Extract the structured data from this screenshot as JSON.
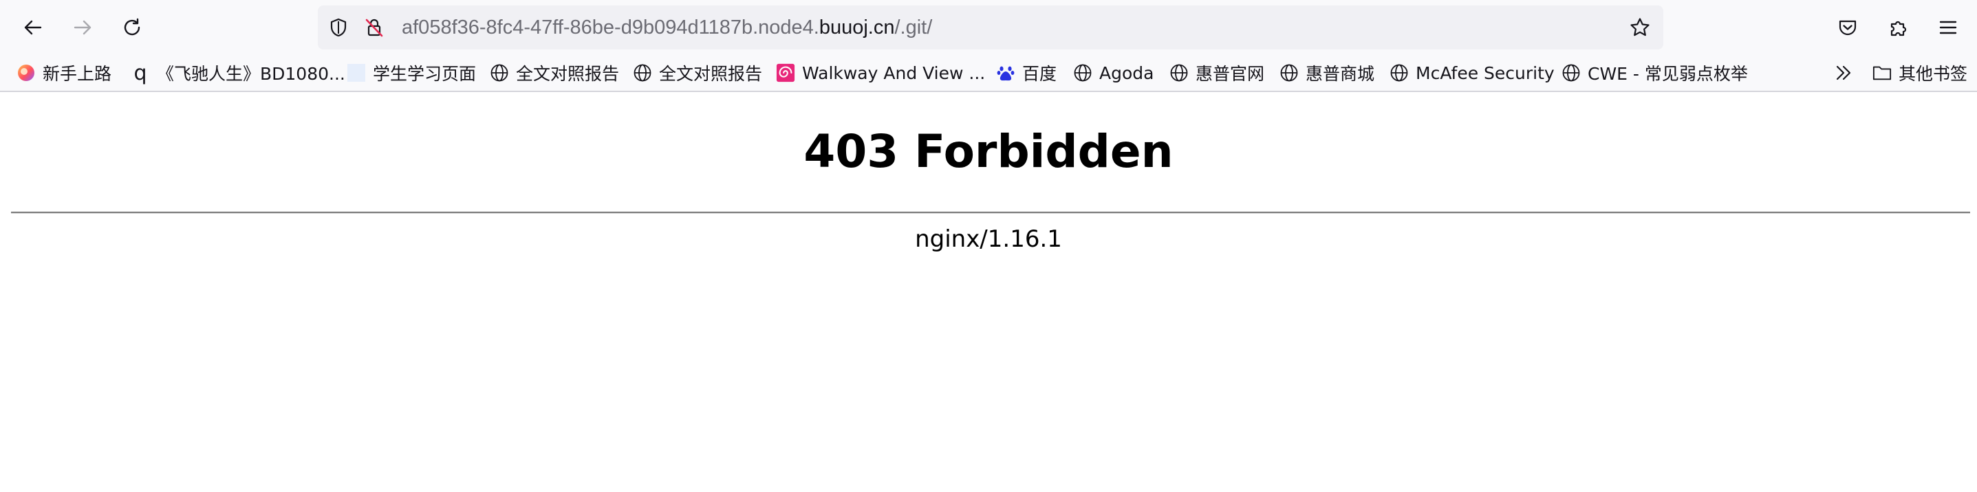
{
  "browser": {
    "url": {
      "prefix": "af058f36-8fc4-47ff-86be-d9b094d1187b.node4.",
      "host": "buuoj.cn",
      "path": "/.git/"
    }
  },
  "bookmarks": {
    "items": [
      {
        "label": "新手上路",
        "icon": "firefox-icon"
      },
      {
        "label": "《飞驰人生》BD1080...",
        "icon": "q-letter-icon",
        "icon_glyph": "q"
      },
      {
        "label": "学生学习页面",
        "icon": "blank-page-icon"
      },
      {
        "label": "全文对照报告",
        "icon": "globe-icon"
      },
      {
        "label": "全文对照报告",
        "icon": "globe-icon"
      },
      {
        "label": "Walkway And View ...",
        "icon": "spiral-logo-icon"
      },
      {
        "label": "百度",
        "icon": "baidu-paw-icon"
      },
      {
        "label": "Agoda",
        "icon": "globe-icon"
      },
      {
        "label": "惠普官网",
        "icon": "globe-icon"
      },
      {
        "label": "惠普商城",
        "icon": "globe-icon"
      },
      {
        "label": "McAfee Security",
        "icon": "globe-icon"
      },
      {
        "label": "CWE - 常见弱点枚举",
        "icon": "globe-icon"
      }
    ],
    "other_label": "其他书签"
  },
  "page": {
    "title": "403 Forbidden",
    "server": "nginx/1.16.1"
  }
}
